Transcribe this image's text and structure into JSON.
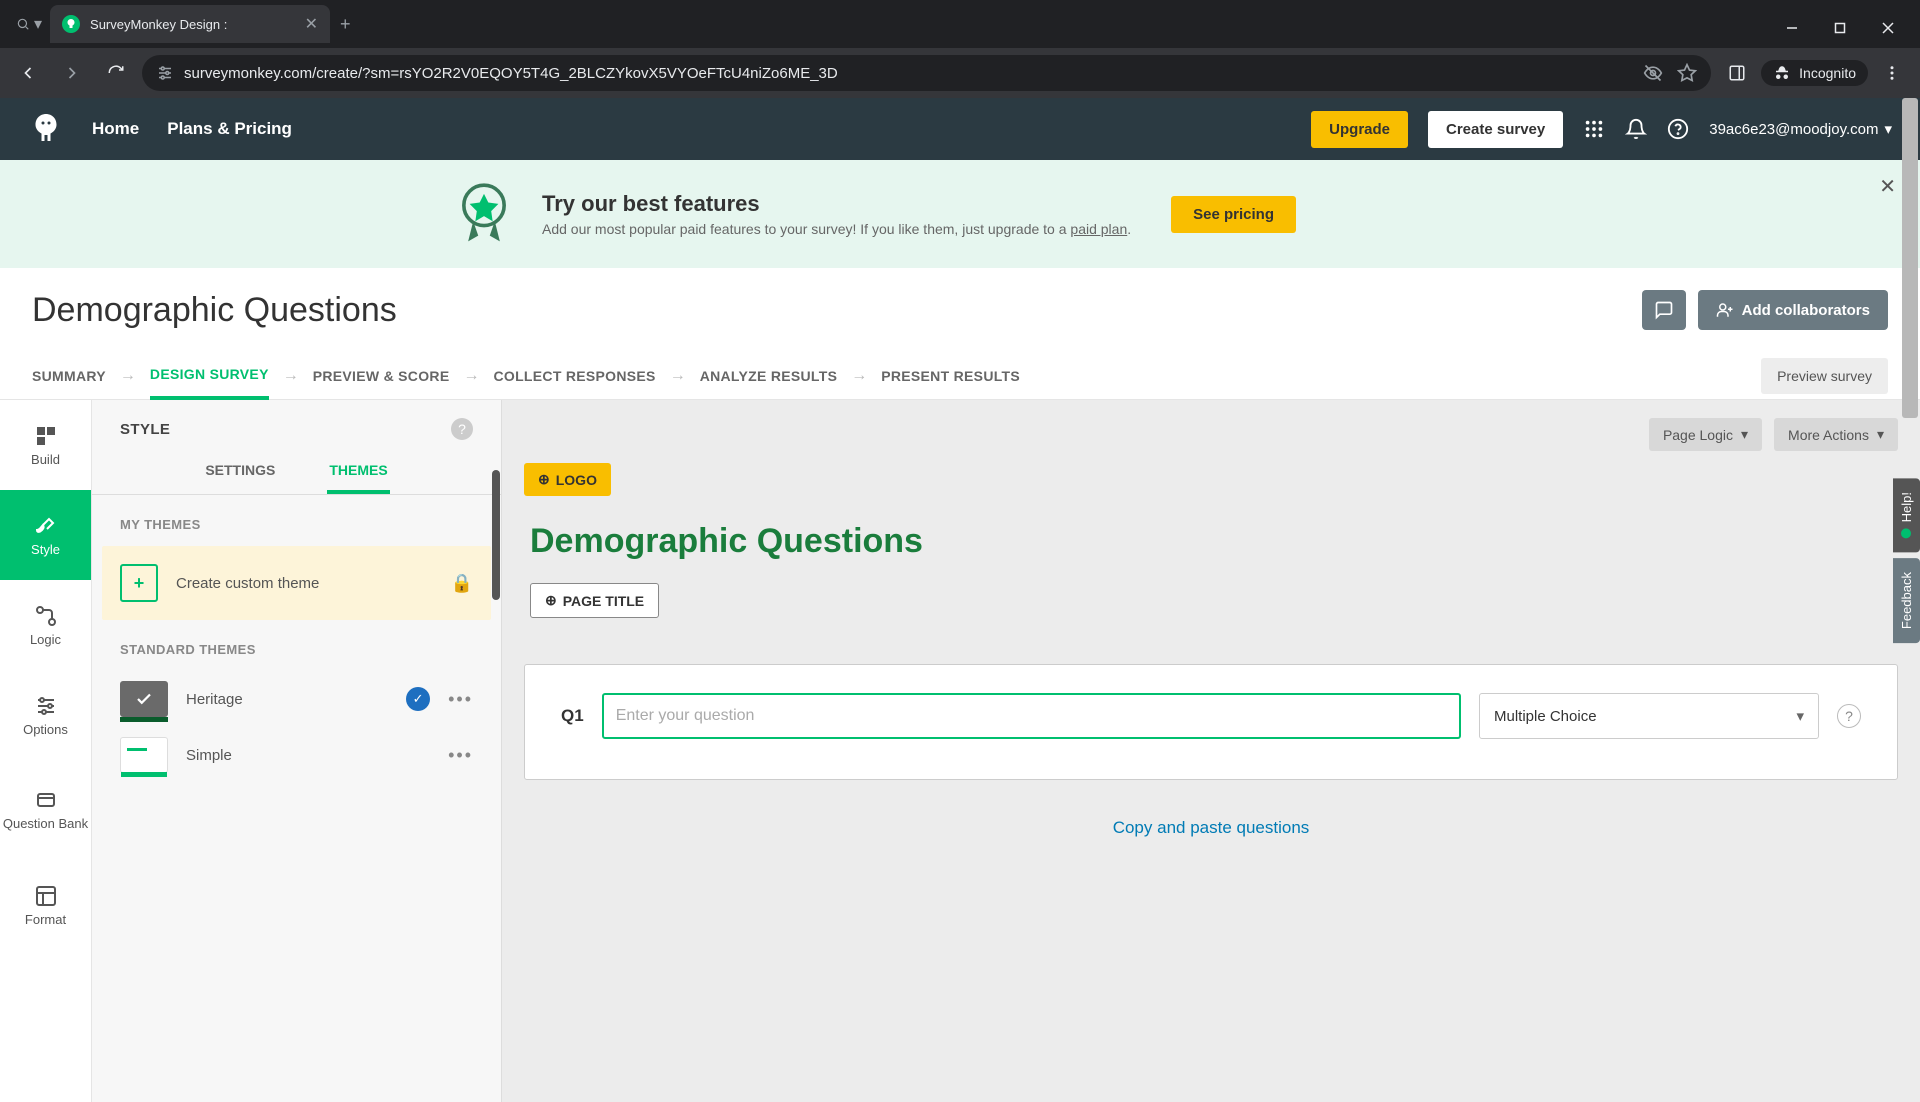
{
  "browser": {
    "tab_title": "SurveyMonkey Design :",
    "url": "surveymonkey.com/create/?sm=rsYO2R2V0EQOY5T4G_2BLCZYkovX5VYOeFTcU4niZo6ME_3D",
    "incognito_label": "Incognito"
  },
  "nav": {
    "home": "Home",
    "plans": "Plans & Pricing",
    "upgrade": "Upgrade",
    "create": "Create survey",
    "user_email": "39ac6e23@moodjoy.com"
  },
  "promo": {
    "title": "Try our best features",
    "subtitle_pre": "Add our most popular paid features to your survey! If you like them, just upgrade to a ",
    "subtitle_link": "paid plan",
    "cta": "See pricing"
  },
  "survey": {
    "title": "Demographic Questions",
    "add_collab": "Add collaborators",
    "preview": "Preview survey"
  },
  "steps": {
    "summary": "SUMMARY",
    "design": "DESIGN SURVEY",
    "preview": "PREVIEW & SCORE",
    "collect": "COLLECT RESPONSES",
    "analyze": "ANALYZE RESULTS",
    "present": "PRESENT RESULTS"
  },
  "rail": {
    "build": "Build",
    "style": "Style",
    "logic": "Logic",
    "options": "Options",
    "qbank": "Question Bank",
    "format": "Format"
  },
  "panel": {
    "title": "STYLE",
    "tab_settings": "SETTINGS",
    "tab_themes": "THEMES",
    "my_themes": "MY THEMES",
    "create_custom": "Create custom theme",
    "standard_themes": "STANDARD THEMES",
    "heritage": "Heritage",
    "simple": "Simple"
  },
  "canvas": {
    "page_logic": "Page Logic",
    "more_actions": "More Actions",
    "logo_btn": "LOGO",
    "survey_heading": "Demographic Questions",
    "page_title_btn": "PAGE TITLE",
    "q1_label": "Q1",
    "q1_placeholder": "Enter your question",
    "q1_type": "Multiple Choice",
    "copy_paste": "Copy and paste questions"
  },
  "side": {
    "help": "Help!",
    "feedback": "Feedback"
  }
}
